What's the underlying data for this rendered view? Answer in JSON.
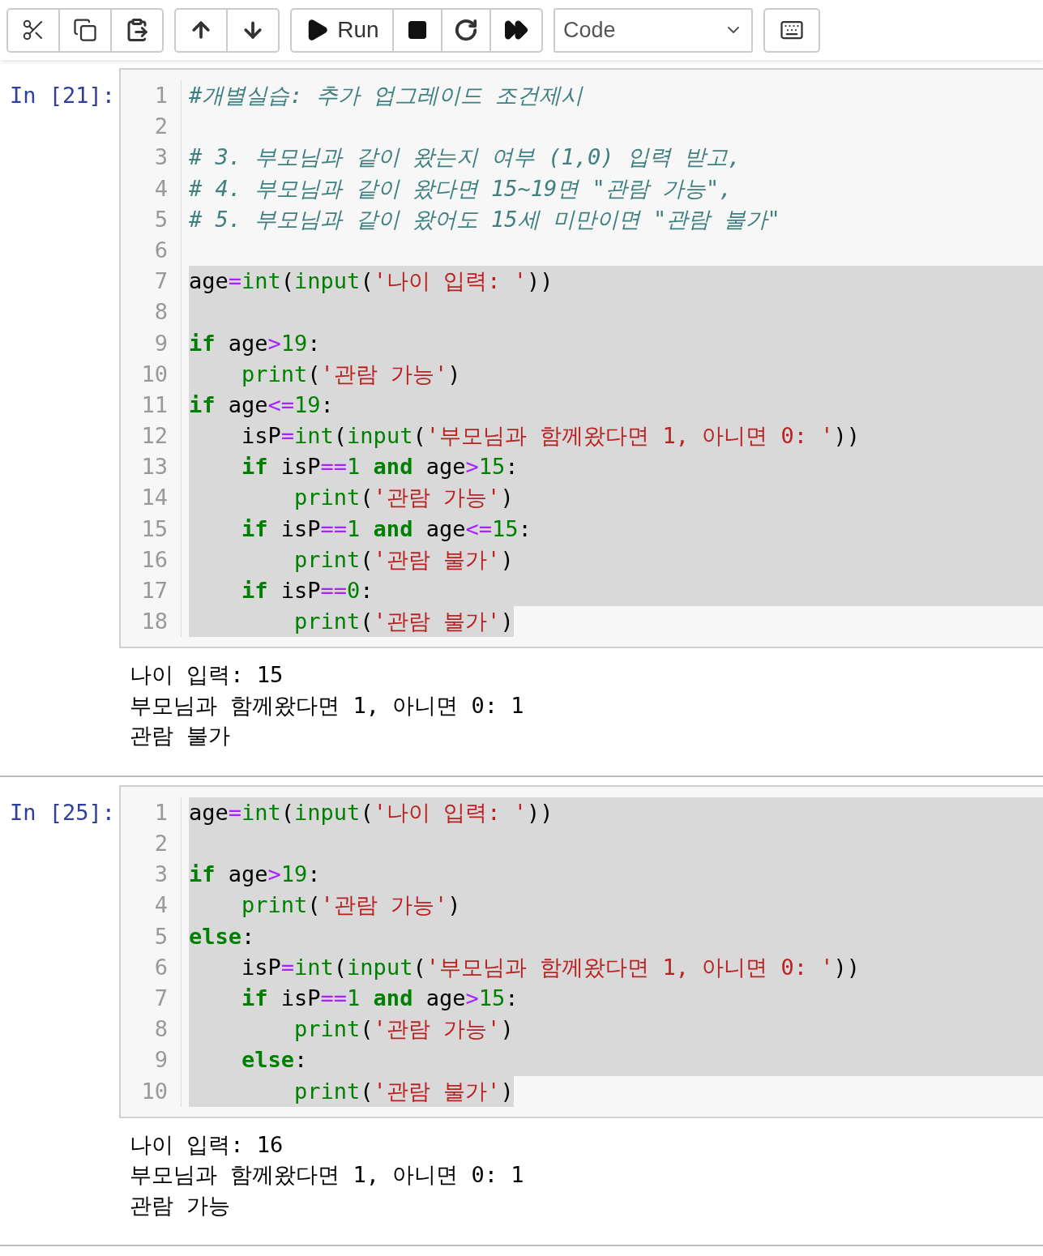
{
  "toolbar": {
    "run_label": "Run",
    "cell_type": "Code"
  },
  "cells": [
    {
      "prompt": "In [21]:",
      "lines": [
        {
          "number": "1",
          "selected": false,
          "tokens": [
            {
              "kind": "comment",
              "text": "#개별실습: 추가 업그레이드 조건제시"
            }
          ]
        },
        {
          "number": "2",
          "selected": false
        },
        {
          "number": "3",
          "selected": false,
          "tokens": [
            {
              "kind": "comment",
              "text": "# 3. 부모님과 같이 왔는지 여부 (1,0) 입력 받고,"
            }
          ]
        },
        {
          "number": "4",
          "selected": false,
          "tokens": [
            {
              "kind": "comment",
              "text": "# 4. 부모님과 같이 왔다면 15~19면 \"관람 가능\","
            }
          ]
        },
        {
          "number": "5",
          "selected": false,
          "tokens": [
            {
              "kind": "comment",
              "text": "# 5. 부모님과 같이 왔어도 15세 미만이면 \"관람 불가\""
            }
          ]
        },
        {
          "number": "6",
          "selected": false
        },
        {
          "number": "7",
          "selected": true,
          "tokens": [
            {
              "kind": "plain",
              "text": "age"
            },
            {
              "kind": "op",
              "text": "="
            },
            {
              "kind": "builtin",
              "text": "int"
            },
            {
              "kind": "plain",
              "text": "("
            },
            {
              "kind": "builtin",
              "text": "input"
            },
            {
              "kind": "plain",
              "text": "("
            },
            {
              "kind": "str",
              "text": "'나이 입력: '"
            },
            {
              "kind": "plain",
              "text": "))"
            }
          ]
        },
        {
          "number": "8",
          "selected": true
        },
        {
          "number": "9",
          "selected": true,
          "tokens": [
            {
              "kind": "kw",
              "text": "if"
            },
            {
              "kind": "plain",
              "text": " age"
            },
            {
              "kind": "op",
              "text": ">"
            },
            {
              "kind": "num",
              "text": "19"
            },
            {
              "kind": "plain",
              "text": ":"
            }
          ]
        },
        {
          "number": "10",
          "selected": true,
          "tokens": [
            {
              "kind": "builtin",
              "text": "    print"
            },
            {
              "kind": "plain",
              "text": "("
            },
            {
              "kind": "str",
              "text": "'관람 가능'"
            },
            {
              "kind": "plain",
              "text": ")"
            }
          ]
        },
        {
          "number": "11",
          "selected": true,
          "tokens": [
            {
              "kind": "kw",
              "text": "if"
            },
            {
              "kind": "plain",
              "text": " age"
            },
            {
              "kind": "op",
              "text": "<="
            },
            {
              "kind": "num",
              "text": "19"
            },
            {
              "kind": "plain",
              "text": ":"
            }
          ]
        },
        {
          "number": "12",
          "selected": true,
          "tokens": [
            {
              "kind": "plain",
              "text": "    isP"
            },
            {
              "kind": "op",
              "text": "="
            },
            {
              "kind": "builtin",
              "text": "int"
            },
            {
              "kind": "plain",
              "text": "("
            },
            {
              "kind": "builtin",
              "text": "input"
            },
            {
              "kind": "plain",
              "text": "("
            },
            {
              "kind": "str",
              "text": "'부모님과 함께왔다면 1, 아니면 0: '"
            },
            {
              "kind": "plain",
              "text": "))"
            }
          ]
        },
        {
          "number": "13",
          "selected": true,
          "tokens": [
            {
              "kind": "kw",
              "text": "    if"
            },
            {
              "kind": "plain",
              "text": " isP"
            },
            {
              "kind": "op",
              "text": "=="
            },
            {
              "kind": "num",
              "text": "1"
            },
            {
              "kind": "kw",
              "text": " and"
            },
            {
              "kind": "plain",
              "text": " age"
            },
            {
              "kind": "op",
              "text": ">"
            },
            {
              "kind": "num",
              "text": "15"
            },
            {
              "kind": "plain",
              "text": ":"
            }
          ]
        },
        {
          "number": "14",
          "selected": true,
          "tokens": [
            {
              "kind": "builtin",
              "text": "        print"
            },
            {
              "kind": "plain",
              "text": "("
            },
            {
              "kind": "str",
              "text": "'관람 가능'"
            },
            {
              "kind": "plain",
              "text": ")"
            }
          ]
        },
        {
          "number": "15",
          "selected": true,
          "tokens": [
            {
              "kind": "kw",
              "text": "    if"
            },
            {
              "kind": "plain",
              "text": " isP"
            },
            {
              "kind": "op",
              "text": "=="
            },
            {
              "kind": "num",
              "text": "1"
            },
            {
              "kind": "kw",
              "text": " and"
            },
            {
              "kind": "plain",
              "text": " age"
            },
            {
              "kind": "op",
              "text": "<="
            },
            {
              "kind": "num",
              "text": "15"
            },
            {
              "kind": "plain",
              "text": ":"
            }
          ]
        },
        {
          "number": "16",
          "selected": true,
          "tokens": [
            {
              "kind": "builtin",
              "text": "        print"
            },
            {
              "kind": "plain",
              "text": "("
            },
            {
              "kind": "str",
              "text": "'관람 불가'"
            },
            {
              "kind": "plain",
              "text": ")"
            }
          ]
        },
        {
          "number": "17",
          "selected": true,
          "tokens": [
            {
              "kind": "kw",
              "text": "    if"
            },
            {
              "kind": "plain",
              "text": " isP"
            },
            {
              "kind": "op",
              "text": "=="
            },
            {
              "kind": "num",
              "text": "0"
            },
            {
              "kind": "plain",
              "text": ":"
            }
          ]
        },
        {
          "number": "18",
          "selected": true,
          "tokens": [
            {
              "kind": "builtin",
              "text": "        print"
            },
            {
              "kind": "plain",
              "text": "("
            },
            {
              "kind": "str",
              "text": "'관람 불가'"
            },
            {
              "kind": "plain",
              "text": ")"
            }
          ]
        }
      ],
      "output": [
        "나이 입력: 15",
        "부모님과 함께왔다면 1, 아니면 0: 1",
        "관람 불가"
      ]
    },
    {
      "prompt": "In [25]:",
      "lines": [
        {
          "number": "1",
          "selected": true,
          "tokens": [
            {
              "kind": "plain",
              "text": "age"
            },
            {
              "kind": "op",
              "text": "="
            },
            {
              "kind": "builtin",
              "text": "int"
            },
            {
              "kind": "plain",
              "text": "("
            },
            {
              "kind": "builtin",
              "text": "input"
            },
            {
              "kind": "plain",
              "text": "("
            },
            {
              "kind": "str",
              "text": "'나이 입력: '"
            },
            {
              "kind": "plain",
              "text": "))"
            }
          ]
        },
        {
          "number": "2",
          "selected": true
        },
        {
          "number": "3",
          "selected": true,
          "tokens": [
            {
              "kind": "kw",
              "text": "if"
            },
            {
              "kind": "plain",
              "text": " age"
            },
            {
              "kind": "op",
              "text": ">"
            },
            {
              "kind": "num",
              "text": "19"
            },
            {
              "kind": "plain",
              "text": ":"
            }
          ]
        },
        {
          "number": "4",
          "selected": true,
          "tokens": [
            {
              "kind": "builtin",
              "text": "    print"
            },
            {
              "kind": "plain",
              "text": "("
            },
            {
              "kind": "str",
              "text": "'관람 가능'"
            },
            {
              "kind": "plain",
              "text": ")"
            }
          ]
        },
        {
          "number": "5",
          "selected": true,
          "tokens": [
            {
              "kind": "kw",
              "text": "else"
            },
            {
              "kind": "plain",
              "text": ":"
            }
          ]
        },
        {
          "number": "6",
          "selected": true,
          "tokens": [
            {
              "kind": "plain",
              "text": "    isP"
            },
            {
              "kind": "op",
              "text": "="
            },
            {
              "kind": "builtin",
              "text": "int"
            },
            {
              "kind": "plain",
              "text": "("
            },
            {
              "kind": "builtin",
              "text": "input"
            },
            {
              "kind": "plain",
              "text": "("
            },
            {
              "kind": "str",
              "text": "'부모님과 함께왔다면 1, 아니면 0: '"
            },
            {
              "kind": "plain",
              "text": "))"
            }
          ]
        },
        {
          "number": "7",
          "selected": true,
          "tokens": [
            {
              "kind": "kw",
              "text": "    if"
            },
            {
              "kind": "plain",
              "text": " isP"
            },
            {
              "kind": "op",
              "text": "=="
            },
            {
              "kind": "num",
              "text": "1"
            },
            {
              "kind": "kw",
              "text": " and"
            },
            {
              "kind": "plain",
              "text": " age"
            },
            {
              "kind": "op",
              "text": ">"
            },
            {
              "kind": "num",
              "text": "15"
            },
            {
              "kind": "plain",
              "text": ":"
            }
          ]
        },
        {
          "number": "8",
          "selected": true,
          "tokens": [
            {
              "kind": "builtin",
              "text": "        print"
            },
            {
              "kind": "plain",
              "text": "("
            },
            {
              "kind": "str",
              "text": "'관람 가능'"
            },
            {
              "kind": "plain",
              "text": ")"
            }
          ]
        },
        {
          "number": "9",
          "selected": true,
          "tokens": [
            {
              "kind": "kw",
              "text": "    else"
            },
            {
              "kind": "plain",
              "text": ":"
            }
          ]
        },
        {
          "number": "10",
          "selected": true,
          "tokens": [
            {
              "kind": "builtin",
              "text": "        print"
            },
            {
              "kind": "plain",
              "text": "("
            },
            {
              "kind": "str",
              "text": "'관람 불가'"
            },
            {
              "kind": "plain",
              "text": ")"
            }
          ]
        }
      ],
      "output": [
        "나이 입력: 16",
        "부모님과 함께왔다면 1, 아니면 0: 1",
        "관람 가능"
      ]
    }
  ]
}
